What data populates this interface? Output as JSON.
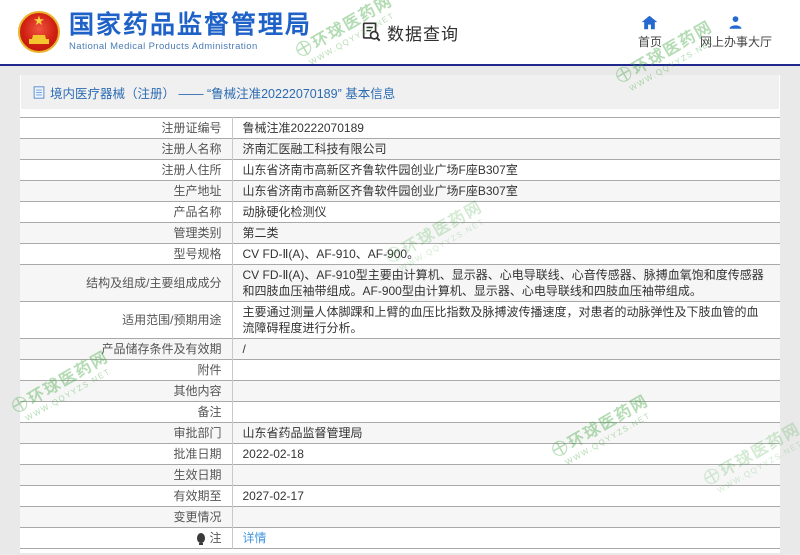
{
  "header": {
    "title": "国家药品监督管理局",
    "subtitle": "National Medical Products Administration",
    "section": "数据查询",
    "nav_home": "首页",
    "nav_hall": "网上办事大厅"
  },
  "breadcrumb": {
    "text": "境内医疗器械（注册） —— “鲁械注准20222070189” 基本信息"
  },
  "table": {
    "rows": [
      {
        "label": "注册证编号",
        "value": "鲁械注准20222070189"
      },
      {
        "label": "注册人名称",
        "value": "济南汇医融工科技有限公司"
      },
      {
        "label": "注册人住所",
        "value": "山东省济南市高新区齐鲁软件园创业广场F座B307室"
      },
      {
        "label": "生产地址",
        "value": "山东省济南市高新区齐鲁软件园创业广场F座B307室"
      },
      {
        "label": "产品名称",
        "value": "动脉硬化检测仪"
      },
      {
        "label": "管理类别",
        "value": "第二类"
      },
      {
        "label": "型号规格",
        "value": "CV FD-Ⅱ(A)、AF-910、AF-900。"
      },
      {
        "label": "结构及组成/主要组成成分",
        "value": "CV FD-Ⅱ(A)、AF-910型主要由计算机、显示器、心电导联线、心音传感器、脉搏血氧饱和度传感器和四肢血压袖带组成。AF-900型由计算机、显示器、心电导联线和四肢血压袖带组成。"
      },
      {
        "label": "适用范围/预期用途",
        "value": "主要通过测量人体脚踝和上臂的血压比指数及脉搏波传播速度，对患者的动脉弹性及下肢血管的血流障碍程度进行分析。"
      },
      {
        "label": "产品储存条件及有效期",
        "value": "/"
      },
      {
        "label": "附件",
        "value": ""
      },
      {
        "label": "其他内容",
        "value": ""
      },
      {
        "label": "备注",
        "value": ""
      },
      {
        "label": "审批部门",
        "value": "山东省药品监督管理局"
      },
      {
        "label": "批准日期",
        "value": "2022-02-18"
      },
      {
        "label": "生效日期",
        "value": ""
      },
      {
        "label": "有效期至",
        "value": "2027-02-17"
      },
      {
        "label": "变更情况",
        "value": ""
      },
      {
        "label": "注",
        "value": "详情",
        "value_type": "link",
        "label_icon": "note-icon"
      }
    ]
  },
  "watermark": {
    "line1": "环球医药网",
    "line2": "WWW.QQYYZS.NET"
  },
  "colors": {
    "title_blue": "#1e62c8",
    "nav_icon_blue": "#2468d0",
    "header_divider": "#20288e",
    "breadcrumb_blue": "#2b6bb3",
    "link_blue": "#4596e0",
    "watermark_green": "#3da43d"
  }
}
